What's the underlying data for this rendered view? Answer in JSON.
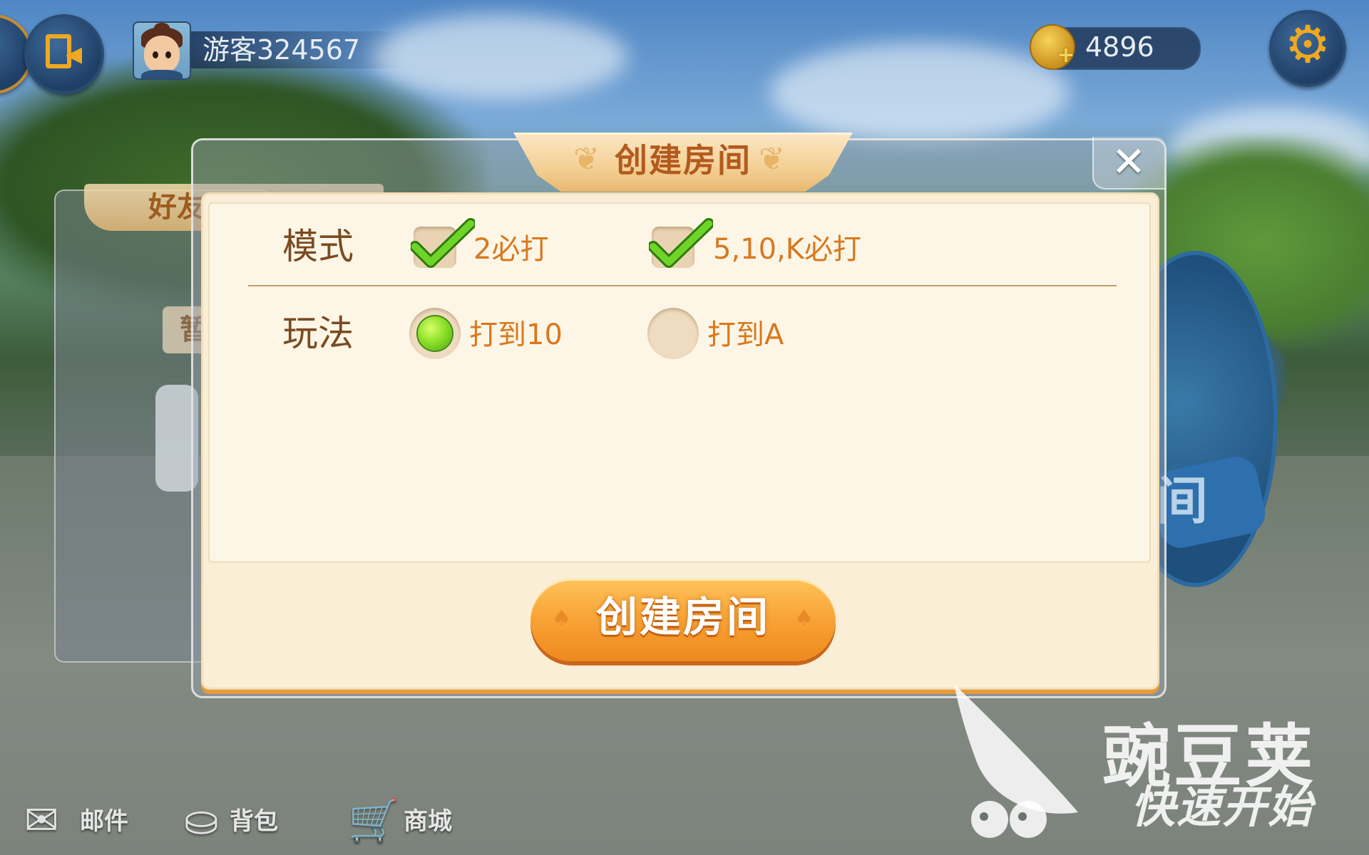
{
  "player": {
    "name": "游客324567"
  },
  "currency": {
    "coins": "4896"
  },
  "background": {
    "tab_label": "好友",
    "chip_label": "暂",
    "right_label": "间"
  },
  "dialog": {
    "title": "创建房间",
    "close_symbol": "✕",
    "rows": [
      {
        "label": "模式",
        "type": "checkbox",
        "options": [
          {
            "label": "2必打",
            "checked": true
          },
          {
            "label": "5,10,K必打",
            "checked": true
          }
        ]
      },
      {
        "label": "玩法",
        "type": "radio",
        "options": [
          {
            "label": "打到10",
            "selected": true
          },
          {
            "label": "打到A",
            "selected": false
          }
        ]
      }
    ],
    "create_button": "创建房间"
  },
  "bottom_nav": [
    {
      "label": "邮件",
      "icon": "mail-icon"
    },
    {
      "label": "背包",
      "icon": "bag-icon"
    },
    {
      "label": "商城",
      "icon": "cart-icon"
    }
  ],
  "watermark": {
    "title": "豌豆荚",
    "subtitle": "快速开始"
  },
  "colors": {
    "accent_orange": "#f8a235",
    "title_brown": "#b35a1e",
    "option_orange": "#d9781e",
    "check_green": "#5cc21a",
    "panel_cream": "#fbeed6"
  }
}
